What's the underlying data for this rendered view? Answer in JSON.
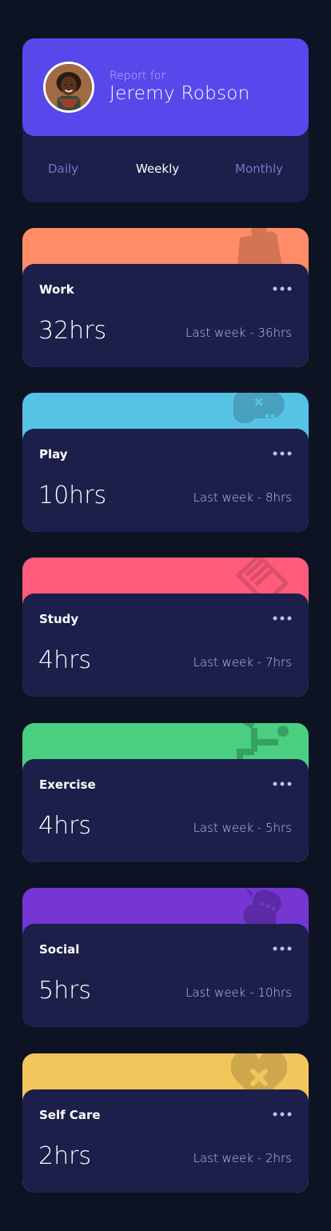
{
  "profile": {
    "report_for": "Report for",
    "name": "Jeremy Robson",
    "avatar_alt": "Jeremy Robson avatar"
  },
  "periods": [
    {
      "label": "Daily",
      "active": false
    },
    {
      "label": "Weekly",
      "active": true
    },
    {
      "label": "Monthly",
      "active": false
    }
  ],
  "activities": [
    {
      "title": "Work",
      "current": "32hrs",
      "previous": "Last week - 36hrs",
      "color": "#ff8c66",
      "icon": "briefcase-icon"
    },
    {
      "title": "Play",
      "current": "10hrs",
      "previous": "Last week - 8hrs",
      "color": "#56c2e6",
      "icon": "gamepad-icon"
    },
    {
      "title": "Study",
      "current": "4hrs",
      "previous": "Last week - 7hrs",
      "color": "#ff5c7c",
      "icon": "book-icon"
    },
    {
      "title": "Exercise",
      "current": "4hrs",
      "previous": "Last week - 5hrs",
      "color": "#4acf81",
      "icon": "running-person-icon"
    },
    {
      "title": "Social",
      "current": "5hrs",
      "previous": "Last week - 10hrs",
      "color": "#7536d3",
      "icon": "chat-bubbles-icon"
    },
    {
      "title": "Self Care",
      "current": "2hrs",
      "previous": "Last week - 2hrs",
      "color": "#f1c65b",
      "icon": "heart-icon"
    }
  ],
  "colors": {
    "background": "#0e1323",
    "card": "#1c1f4a",
    "profile_accent": "#5847eb",
    "muted_text": "#bbc0ff",
    "inactive_tab": "#7078c9"
  }
}
